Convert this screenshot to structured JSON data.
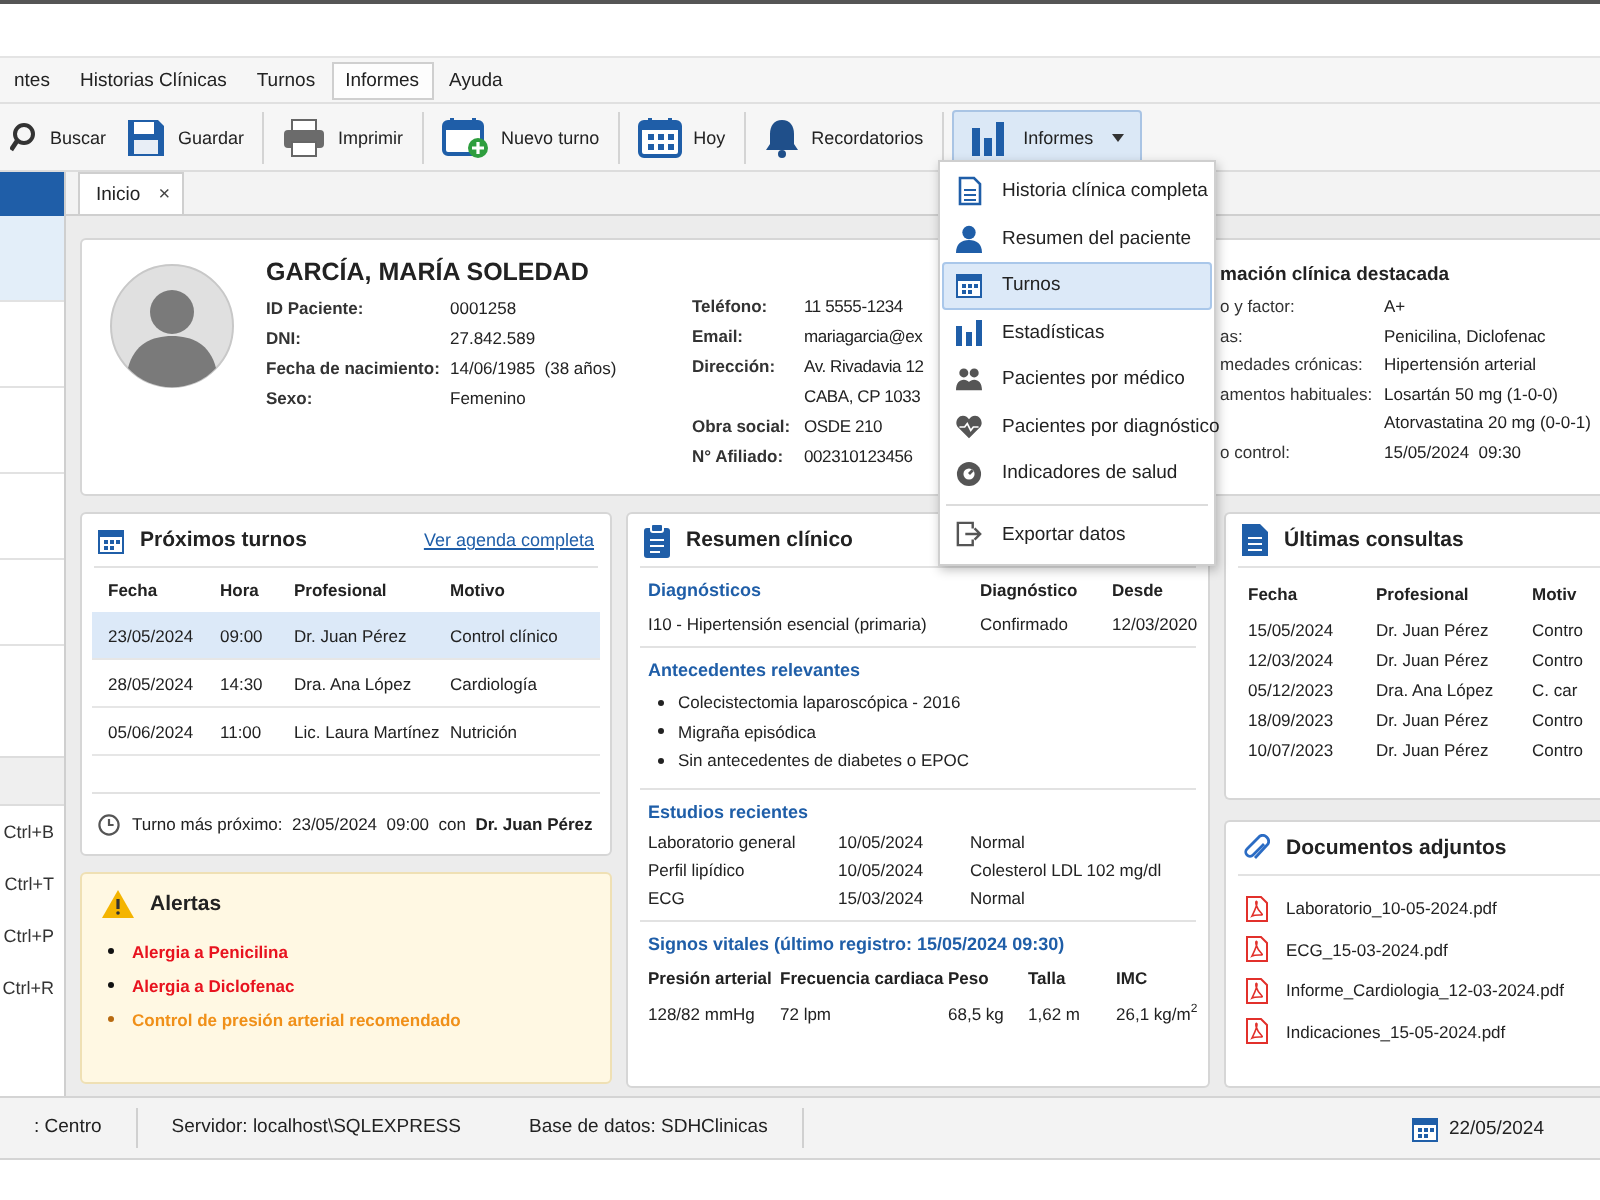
{
  "menu_bar": [
    {
      "label": "ntes",
      "selected": false
    },
    {
      "label": "Historias Clínicas",
      "selected": false
    },
    {
      "label": "Turnos",
      "selected": false
    },
    {
      "label": "Informes",
      "selected": true
    },
    {
      "label": "Ayuda",
      "selected": false
    }
  ],
  "toolbar": [
    {
      "label": "Buscar",
      "pressed": false,
      "dropdown": false
    },
    {
      "label": "Guardar",
      "pressed": false,
      "dropdown": false
    },
    {
      "label": "Imprimir",
      "pressed": false,
      "dropdown": false
    },
    {
      "label": "Nuevo turno",
      "pressed": false,
      "dropdown": false
    },
    {
      "label": "Hoy",
      "pressed": false,
      "dropdown": false
    },
    {
      "label": "Recordatorios",
      "pressed": false,
      "dropdown": false
    },
    {
      "label": "Informes",
      "pressed": true,
      "dropdown": true
    }
  ],
  "sidebar": {
    "items": [
      {
        "selected": true
      },
      {
        "selected": false
      },
      {
        "selected": false
      },
      {
        "selected": false
      },
      {
        "selected": false
      }
    ],
    "shortcuts": [
      "Ctrl+B",
      "Ctrl+T",
      "Ctrl+P",
      "Ctrl+R"
    ]
  },
  "tabs": [
    {
      "label": "Inicio",
      "close": "×",
      "selected": true
    }
  ],
  "patient": {
    "name": "GARCÍA, MARÍA SOLEDAD",
    "fields": [
      {
        "label": "ID Paciente:",
        "value": "0001258"
      },
      {
        "label": "DNI:",
        "value": "27.842.589"
      },
      {
        "label": "Fecha de nacimiento:",
        "value": "14/06/1985  (38 años)"
      },
      {
        "label": "Sexo:",
        "value": "Femenino"
      }
    ],
    "contact": [
      {
        "label": "Teléfono:",
        "lines": [
          "11 5555-1234"
        ]
      },
      {
        "label": "Email:",
        "lines": [
          "mariagarcia@ex"
        ]
      },
      {
        "label": "Dirección:",
        "lines": [
          "Av. Rivadavia 12",
          "CABA, CP 1033"
        ]
      },
      {
        "label": "Obra social:",
        "lines": [
          "OSDE 210"
        ]
      },
      {
        "label": "N° Afiliado:",
        "lines": [
          "002310123456"
        ]
      }
    ]
  },
  "clinical_info": {
    "title": "mación clínica destacada",
    "rows": [
      {
        "label": "o y factor:",
        "lines": [
          "A+"
        ]
      },
      {
        "label": "as:",
        "lines": [
          "Penicilina, Diclofenac"
        ]
      },
      {
        "label": "medades crónicas:",
        "lines": [
          "Hipertensión arterial"
        ]
      },
      {
        "label": "amentos habituales:",
        "lines": [
          "Losartán 50 mg (1-0-0)",
          "Atorvastatina 20 mg (0-0-1)"
        ]
      },
      {
        "label": "o control:",
        "lines": [
          "15/05/2024  09:30"
        ]
      }
    ]
  },
  "reports_menu": {
    "groups": [
      [
        {
          "label": "Historia clínica completa",
          "selected": false
        },
        {
          "label": "Resumen del paciente",
          "selected": false
        },
        {
          "label": "Turnos",
          "selected": true
        },
        {
          "label": "Estadísticas",
          "selected": false
        },
        {
          "label": "Pacientes por médico",
          "selected": false
        },
        {
          "label": "Pacientes por diagnóstico",
          "selected": false
        },
        {
          "label": "Indicadores de salud",
          "selected": false
        }
      ],
      [
        {
          "label": "Exportar datos",
          "selected": false
        }
      ]
    ]
  },
  "appointments": {
    "title": "Próximos turnos",
    "link": "Ver agenda completa",
    "columns": [
      "Fecha",
      "Hora",
      "Profesional",
      "Motivo"
    ],
    "rows": [
      {
        "cells": [
          "23/05/2024",
          "09:00",
          "Dr. Juan Pérez",
          "Control clínico"
        ],
        "selected": true
      },
      {
        "cells": [
          "28/05/2024",
          "14:30",
          "Dra. Ana López",
          "Cardiología"
        ],
        "selected": false
      },
      {
        "cells": [
          "05/06/2024",
          "11:00",
          "Lic. Laura Martínez",
          "Nutrición"
        ],
        "selected": false
      }
    ],
    "footer": "Turno más próximo:  23/05/2024  09:00  con  **Dr. Juan Pérez**"
  },
  "alerts": {
    "title": "Alertas",
    "items": [
      {
        "text": "Alergia a Penicilina",
        "kind": "danger"
      },
      {
        "text": "Alergia a Diclofenac",
        "kind": "danger"
      },
      {
        "text": "Control de presión arterial recomendado",
        "kind": "warning"
      }
    ]
  },
  "clinical_summary": {
    "title": "Resumen clínico",
    "diagnoses": {
      "columns": [
        "Diagnósticos",
        "Diagnóstico",
        "Desde"
      ],
      "rows": [
        [
          "I10 - Hipertensión esencial (primaria)",
          "Confirmado",
          "12/03/2020"
        ]
      ]
    },
    "history": {
      "title": "Antecedentes relevantes",
      "items": [
        "Colecistectomia laparoscópica - 2016",
        "Migraña episódica",
        "Sin antecedentes de diabetes o EPOC"
      ]
    },
    "studies": {
      "title": "Estudios recientes",
      "rows": [
        [
          "Laboratorio general",
          "10/05/2024",
          "Normal"
        ],
        [
          "Perfil lipídico",
          "10/05/2024",
          "Colesterol LDL 102 mg/dl"
        ],
        [
          "ECG",
          "15/03/2024",
          "Normal"
        ]
      ]
    },
    "vitals": {
      "title": "Signos vitales (último registro: 15/05/2024 09:30)",
      "columns": [
        "Presión arterial",
        "Frecuencia cardiaca",
        "Peso",
        "Talla",
        "IMC"
      ],
      "values": [
        "128/82 mmHg",
        "72 lpm",
        "68,5 kg",
        "1,62 m",
        "26,1 kg/m$^{2}$"
      ]
    }
  },
  "recent_visits": {
    "title": "Últimas consultas",
    "columns": [
      "Fecha",
      "Profesional",
      "Motiv"
    ],
    "rows": [
      [
        "15/05/2024",
        "Dr. Juan Pérez",
        "Contro"
      ],
      [
        "12/03/2024",
        "Dr. Juan Pérez",
        "Contro"
      ],
      [
        "05/12/2023",
        "Dra. Ana López",
        "C. car"
      ],
      [
        "18/09/2023",
        "Dr. Juan Pérez",
        "Contro"
      ],
      [
        "10/07/2023",
        "Dr. Juan Pérez",
        "Contro"
      ]
    ]
  },
  "attachments": {
    "title": "Documentos adjuntos",
    "files": [
      "Laboratorio_10-05-2024.pdf",
      "ECG_15-03-2024.pdf",
      "Informe_Cardiologia_12-03-2024.pdf",
      "Indicaciones_15-05-2024.pdf"
    ]
  },
  "status_bar": {
    "items": [
      ": Centro",
      "Servidor: localhost\\SQLEXPRESS",
      "Base de datos: SDHClinicas"
    ],
    "date": "22/05/2024"
  }
}
